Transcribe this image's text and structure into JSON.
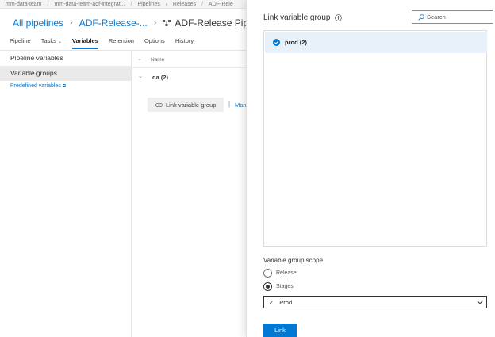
{
  "breadcrumbs": [
    "mm-data-team",
    "mm-data-team-adf-integrat...",
    "Pipelines",
    "Releases",
    "ADF-Rele"
  ],
  "header": {
    "all_pipelines": "All pipelines",
    "release_short": "ADF-Release-...",
    "pipeline_title": "ADF-Release Pipeline"
  },
  "tabs": [
    {
      "label": "Pipeline",
      "active": false
    },
    {
      "label": "Tasks",
      "active": false,
      "dropdown": true
    },
    {
      "label": "Variables",
      "active": true
    },
    {
      "label": "Retention",
      "active": false
    },
    {
      "label": "Options",
      "active": false
    },
    {
      "label": "History",
      "active": false
    }
  ],
  "left_nav": {
    "items": [
      "Pipeline variables",
      "Variable groups"
    ],
    "selected": "Variable groups",
    "predefined_link": "Predefined variables"
  },
  "content": {
    "column_header": "Name",
    "group_name": "qa (2)",
    "link_button": "Link variable group",
    "manage_link": "Man"
  },
  "panel": {
    "title": "Link variable group",
    "search_placeholder": "Search",
    "groups": [
      {
        "label": "prod (2)",
        "selected": true
      }
    ],
    "scope_label": "Variable group scope",
    "scope_options": [
      {
        "label": "Release",
        "checked": false
      },
      {
        "label": "Stages",
        "checked": true
      }
    ],
    "stages_value": "Prod",
    "link_button": "Link"
  },
  "colors": {
    "accent": "#0078d4",
    "selected_row": "#e8f1fa",
    "nav_selected": "#eaeaea"
  }
}
